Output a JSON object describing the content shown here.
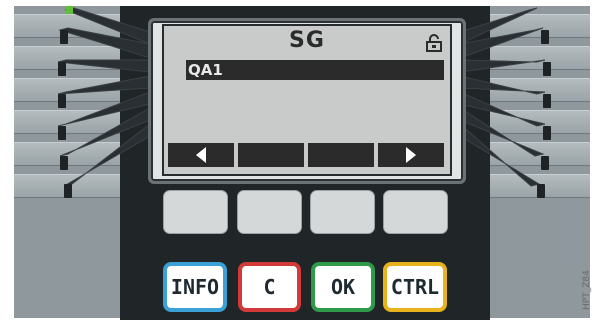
{
  "display": {
    "title": "SG",
    "selected_item": "QA1",
    "lock_icon": "lock-icon",
    "softkeys": [
      {
        "icon": "arrow-left-icon"
      },
      {
        "icon": ""
      },
      {
        "icon": ""
      },
      {
        "icon": "arrow-right-icon"
      }
    ]
  },
  "buttons": {
    "info": "INFO",
    "clear": "C",
    "ok": "OK",
    "ctrl": "CTRL"
  },
  "figure_code": "HPT_Z84",
  "colors": {
    "info": "#3aa0d6",
    "clear": "#d23a3a",
    "ok": "#2f9a4a",
    "ctrl": "#e7b21c",
    "led": "#5fbf3a"
  }
}
